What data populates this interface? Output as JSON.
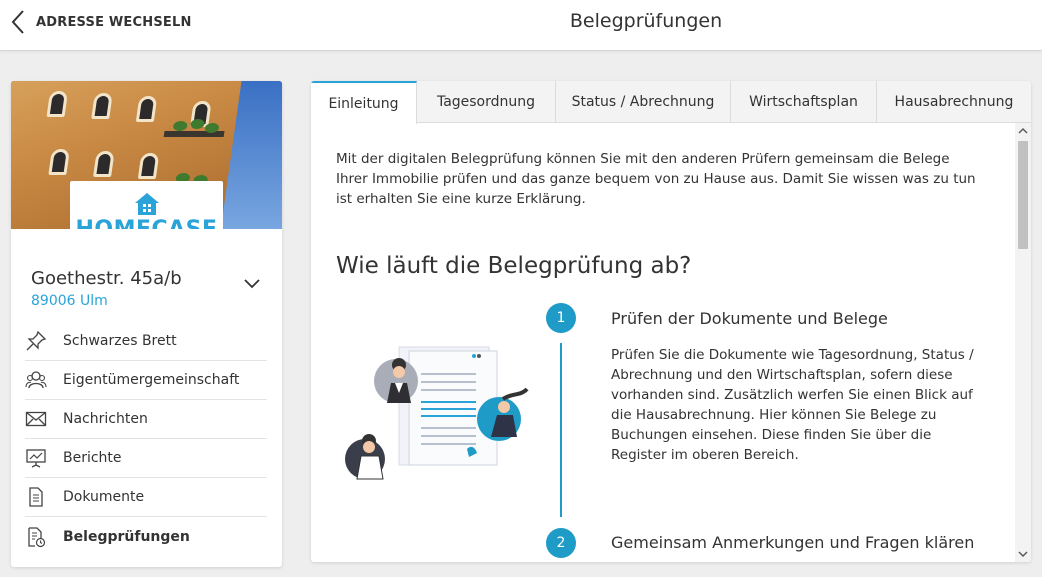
{
  "header": {
    "back_label": "ADRESSE WECHSELN",
    "title": "Belegprüfungen"
  },
  "sidebar": {
    "logo_text": "HOMECASE",
    "address": "Goethestr. 45a/b",
    "city": "89006 Ulm",
    "items": [
      {
        "label": "Schwarzes Brett",
        "icon": "pin-icon"
      },
      {
        "label": "Eigentümergemeinschaft",
        "icon": "community-icon"
      },
      {
        "label": "Nachrichten",
        "icon": "envelope-icon"
      },
      {
        "label": "Berichte",
        "icon": "presentation-icon"
      },
      {
        "label": "Dokumente",
        "icon": "document-icon"
      },
      {
        "label": "Belegprüfungen",
        "icon": "audit-document-icon",
        "active": true
      }
    ]
  },
  "tabs": [
    {
      "label": "Einleitung",
      "active": true
    },
    {
      "label": "Tagesordnung"
    },
    {
      "label": "Status / Abrechnung"
    },
    {
      "label": "Wirtschaftsplan"
    },
    {
      "label": "Hausabrechnung"
    }
  ],
  "content": {
    "intro": "Mit der digitalen Belegprüfung können Sie mit den anderen Prüfern gemeinsam die Belege Ihrer Immobilie prüfen und das ganze bequem von zu Hause aus. Damit Sie wissen was zu tun ist erhalten Sie eine kurze Erklärung.",
    "heading": "Wie läuft die Belegprüfung ab?",
    "steps": [
      {
        "number": "1",
        "title": "Prüfen der Dokumente und Belege",
        "text": "Prüfen Sie die Dokumente wie Tagesordnung, Status / Abrechnung und den Wirtschaftsplan, sofern diese vorhanden sind. Zusätzlich werfen Sie einen Blick auf die Hausabrechnung. Hier können Sie Belege zu Buchungen einsehen. Diese finden Sie über die Register im oberen Bereich."
      },
      {
        "number": "2",
        "title": "Gemeinsam Anmerkungen und Fragen klären"
      }
    ]
  },
  "colors": {
    "accent": "#2aa3d8",
    "timeline": "#1e9bc7",
    "background": "#eeeeee"
  }
}
